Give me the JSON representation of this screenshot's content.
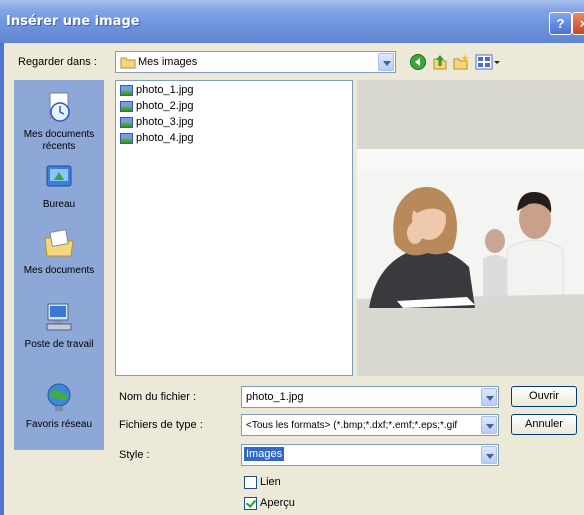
{
  "window": {
    "title": "Insérer une image",
    "help_label": "?",
    "close_label": "×"
  },
  "lookin": {
    "label": "Regarder dans :",
    "value": "Mes images"
  },
  "toolbar_icons": [
    "back-icon",
    "up-folder-icon",
    "new-folder-icon",
    "view-menu-icon"
  ],
  "places": [
    {
      "label": "Mes documents récents",
      "icon": "recent-documents-icon"
    },
    {
      "label": "Bureau",
      "icon": "desktop-icon"
    },
    {
      "label": "Mes documents",
      "icon": "my-documents-icon"
    },
    {
      "label": "Poste de travail",
      "icon": "my-computer-icon"
    },
    {
      "label": "Favoris réseau",
      "icon": "network-places-icon"
    }
  ],
  "files": [
    "photo_1.jpg",
    "photo_2.jpg",
    "photo_3.jpg",
    "photo_4.jpg"
  ],
  "filename": {
    "label": "Nom du fichier :",
    "value": "photo_1.jpg"
  },
  "filetype": {
    "label": "Fichiers de type :",
    "value": "<Tous les formats> (*.bmp;*.dxf;*.emf;*.eps;*.gif"
  },
  "style": {
    "label": "Style :",
    "value": "Images"
  },
  "options": [
    {
      "label": "Lien",
      "checked": false
    },
    {
      "label": "Aperçu",
      "checked": true
    }
  ],
  "buttons": {
    "open": "Ouvrir",
    "cancel": "Annuler"
  },
  "colors": {
    "titlebar": "#6F93DC",
    "places_bar": "#8DA7D6",
    "dialog_bg": "#ECE9D8",
    "selection": "#316AC5"
  }
}
